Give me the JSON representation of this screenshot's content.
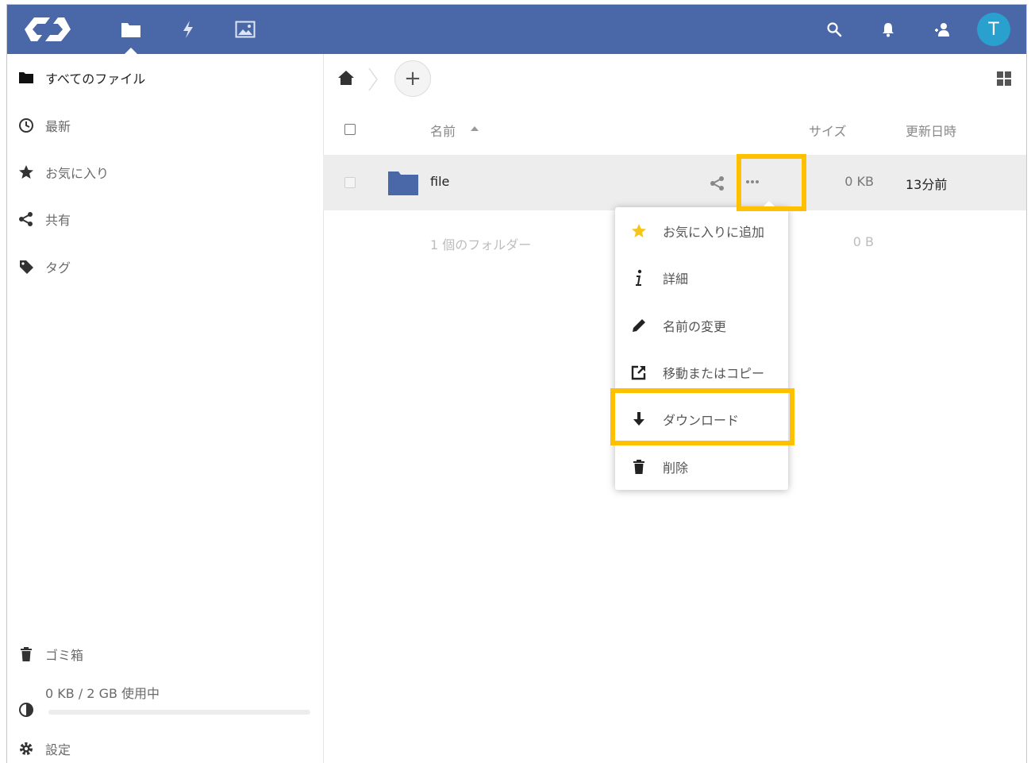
{
  "header": {
    "apps": [
      {
        "name": "files",
        "icon": "folder-icon",
        "active": true
      },
      {
        "name": "activity",
        "icon": "lightning-icon",
        "active": false
      },
      {
        "name": "gallery",
        "icon": "image-icon",
        "active": false
      }
    ],
    "avatar_initial": "T",
    "colors": {
      "bar": "#4a68a8",
      "avatar": "#2aa0cf"
    }
  },
  "sidebar": {
    "items": [
      {
        "label": "すべてのファイル",
        "icon": "folder-icon"
      },
      {
        "label": "最新",
        "icon": "clock-icon"
      },
      {
        "label": "お気に入り",
        "icon": "star-icon"
      },
      {
        "label": "共有",
        "icon": "share-icon"
      },
      {
        "label": "タグ",
        "icon": "tag-icon"
      }
    ],
    "trash_label": "ゴミ箱",
    "quota_label": "0 KB / 2 GB 使用中",
    "quota_fraction": 0.0,
    "settings_label": "設定"
  },
  "file_list": {
    "columns": {
      "name": "名前",
      "size": "サイズ",
      "modified": "更新日時"
    },
    "rows": [
      {
        "name": "file",
        "size": "0 KB",
        "modified": "13分前"
      }
    ],
    "summary": {
      "label": "1 個のフォルダー",
      "size": "0 B"
    }
  },
  "menu": {
    "items": [
      {
        "label": "お気に入りに追加",
        "icon": "star-icon"
      },
      {
        "label": "詳細",
        "icon": "info-icon"
      },
      {
        "label": "名前の変更",
        "icon": "pencil-icon"
      },
      {
        "label": "移動またはコピー",
        "icon": "external-link-icon"
      },
      {
        "label": "ダウンロード",
        "icon": "download-icon"
      },
      {
        "label": "削除",
        "icon": "trash-icon"
      }
    ]
  },
  "highlight_color": "#ffc000"
}
